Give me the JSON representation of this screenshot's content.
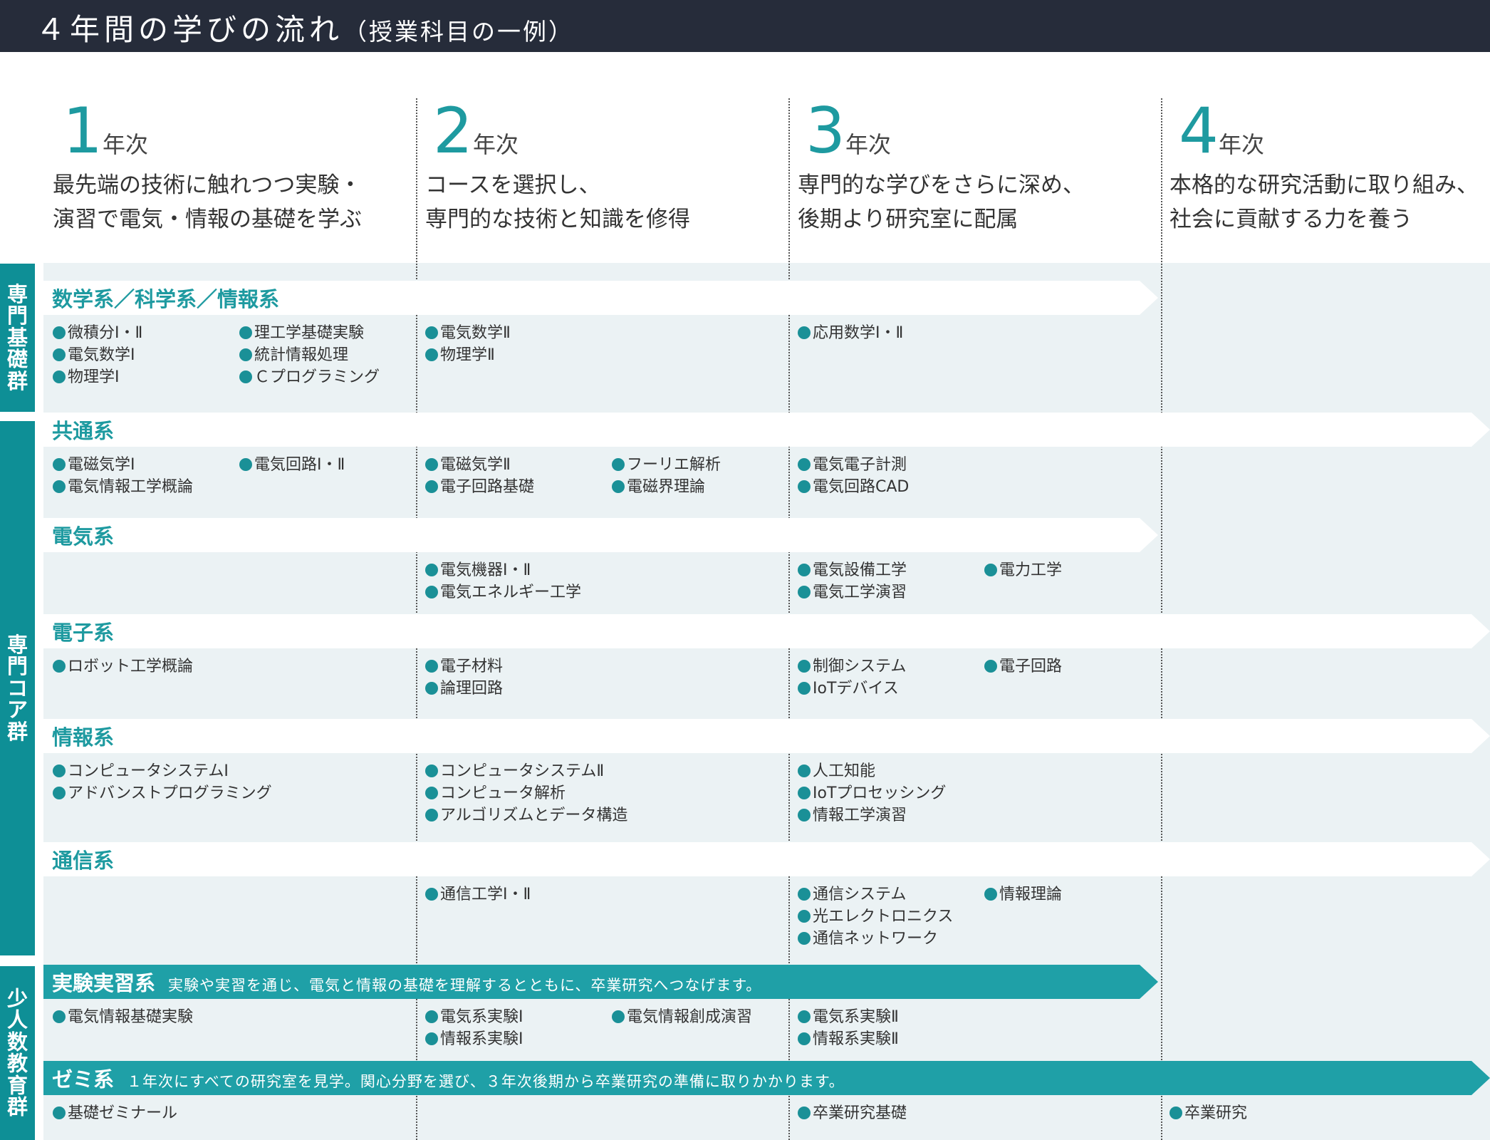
{
  "header": {
    "title": "４年間の学びの流れ",
    "subtitle": "（授業科目の一例）"
  },
  "years": [
    {
      "num": "1",
      "suffix": "年次",
      "line1": "最先端の技術に触れつつ実験・",
      "line2": "演習で電気・情報の基礎を学ぶ"
    },
    {
      "num": "2",
      "suffix": "年次",
      "line1": "コースを選択し、",
      "line2": "専門的な技術と知識を修得"
    },
    {
      "num": "3",
      "suffix": "年次",
      "line1": "専門的な学びをさらに深め、",
      "line2": "後期より研究室に配属"
    },
    {
      "num": "4",
      "suffix": "年次",
      "line1": "本格的な研究活動に取り組み、",
      "line2": "社会に貢献する力を養う"
    }
  ],
  "groups": [
    {
      "label": "専門基礎群"
    },
    {
      "label": "専門コア群"
    },
    {
      "label": "少人数教育群"
    }
  ],
  "categories": [
    {
      "label": "数学系／科学系／情報系",
      "desc": "",
      "items": [
        [
          [
            "微積分Ⅰ・Ⅱ",
            "電気数学Ⅰ",
            "物理学Ⅰ"
          ],
          [
            "理工学基礎実験",
            "統計情報処理",
            "Ｃプログラミング"
          ]
        ],
        [
          [
            "電気数学Ⅱ",
            "物理学Ⅱ"
          ],
          []
        ],
        [
          [
            "応用数学Ⅰ・Ⅱ"
          ],
          []
        ],
        [
          [],
          []
        ]
      ]
    },
    {
      "label": "共通系",
      "desc": "",
      "items": [
        [
          [
            "電磁気学Ⅰ",
            "電気情報工学概論"
          ],
          [
            "電気回路Ⅰ・Ⅱ"
          ]
        ],
        [
          [
            "電磁気学Ⅱ",
            "電子回路基礎"
          ],
          [
            "フーリエ解析",
            "電磁界理論"
          ]
        ],
        [
          [
            "電気電子計測",
            "電気回路CAD"
          ],
          []
        ],
        [
          [],
          []
        ]
      ]
    },
    {
      "label": "電気系",
      "desc": "",
      "items": [
        [
          [],
          []
        ],
        [
          [
            "電気機器Ⅰ・Ⅱ",
            "電気エネルギー工学"
          ],
          []
        ],
        [
          [
            "電気設備工学",
            "電気工学演習"
          ],
          [
            "電力工学"
          ]
        ],
        [
          [],
          []
        ]
      ]
    },
    {
      "label": "電子系",
      "desc": "",
      "items": [
        [
          [
            "ロボット工学概論"
          ],
          []
        ],
        [
          [
            "電子材料",
            "論理回路"
          ],
          []
        ],
        [
          [
            "制御システム",
            "IoTデバイス"
          ],
          [
            "電子回路"
          ]
        ],
        [
          [],
          []
        ]
      ]
    },
    {
      "label": "情報系",
      "desc": "",
      "items": [
        [
          [
            "コンピュータシステムⅠ",
            "アドバンストプログラミング"
          ],
          []
        ],
        [
          [
            "コンピュータシステムⅡ",
            "コンピュータ解析",
            "アルゴリズムとデータ構造"
          ],
          []
        ],
        [
          [
            "人工知能",
            "IoTプロセッシング",
            "情報工学演習"
          ],
          []
        ],
        [
          [],
          []
        ]
      ]
    },
    {
      "label": "通信系",
      "desc": "",
      "items": [
        [
          [],
          []
        ],
        [
          [
            "通信工学Ⅰ・Ⅱ"
          ],
          []
        ],
        [
          [
            "通信システム",
            "光エレクトロニクス",
            "通信ネットワーク"
          ],
          [
            "情報理論"
          ]
        ],
        [
          [],
          []
        ]
      ]
    },
    {
      "label": "実験実習系",
      "desc": "実験や実習を通じ、電気と情報の基礎を理解するとともに、卒業研究へつなげます。",
      "items": [
        [
          [
            "電気情報基礎実験"
          ],
          []
        ],
        [
          [
            "電気系実験Ⅰ",
            "情報系実験Ⅰ"
          ],
          [
            "電気情報創成演習"
          ]
        ],
        [
          [
            "電気系実験Ⅱ",
            "情報系実験Ⅱ"
          ],
          []
        ],
        [
          [],
          []
        ]
      ]
    },
    {
      "label": "ゼミ系",
      "desc": "１年次にすべての研究室を見学。関心分野を選び、３年次後期から卒業研究の準備に取りかかります。",
      "items": [
        [
          [
            "基礎ゼミナール"
          ],
          []
        ],
        [
          [],
          []
        ],
        [
          [
            "卒業研究基礎"
          ],
          []
        ],
        [
          [
            "卒業研究"
          ],
          []
        ]
      ]
    }
  ],
  "colors": {
    "teal": "#1fa0a7",
    "teal_text": "#1e9aa0",
    "dot": "#1a9097",
    "header_bg": "#262c3a",
    "panel_bg": "#ebf2f4"
  }
}
